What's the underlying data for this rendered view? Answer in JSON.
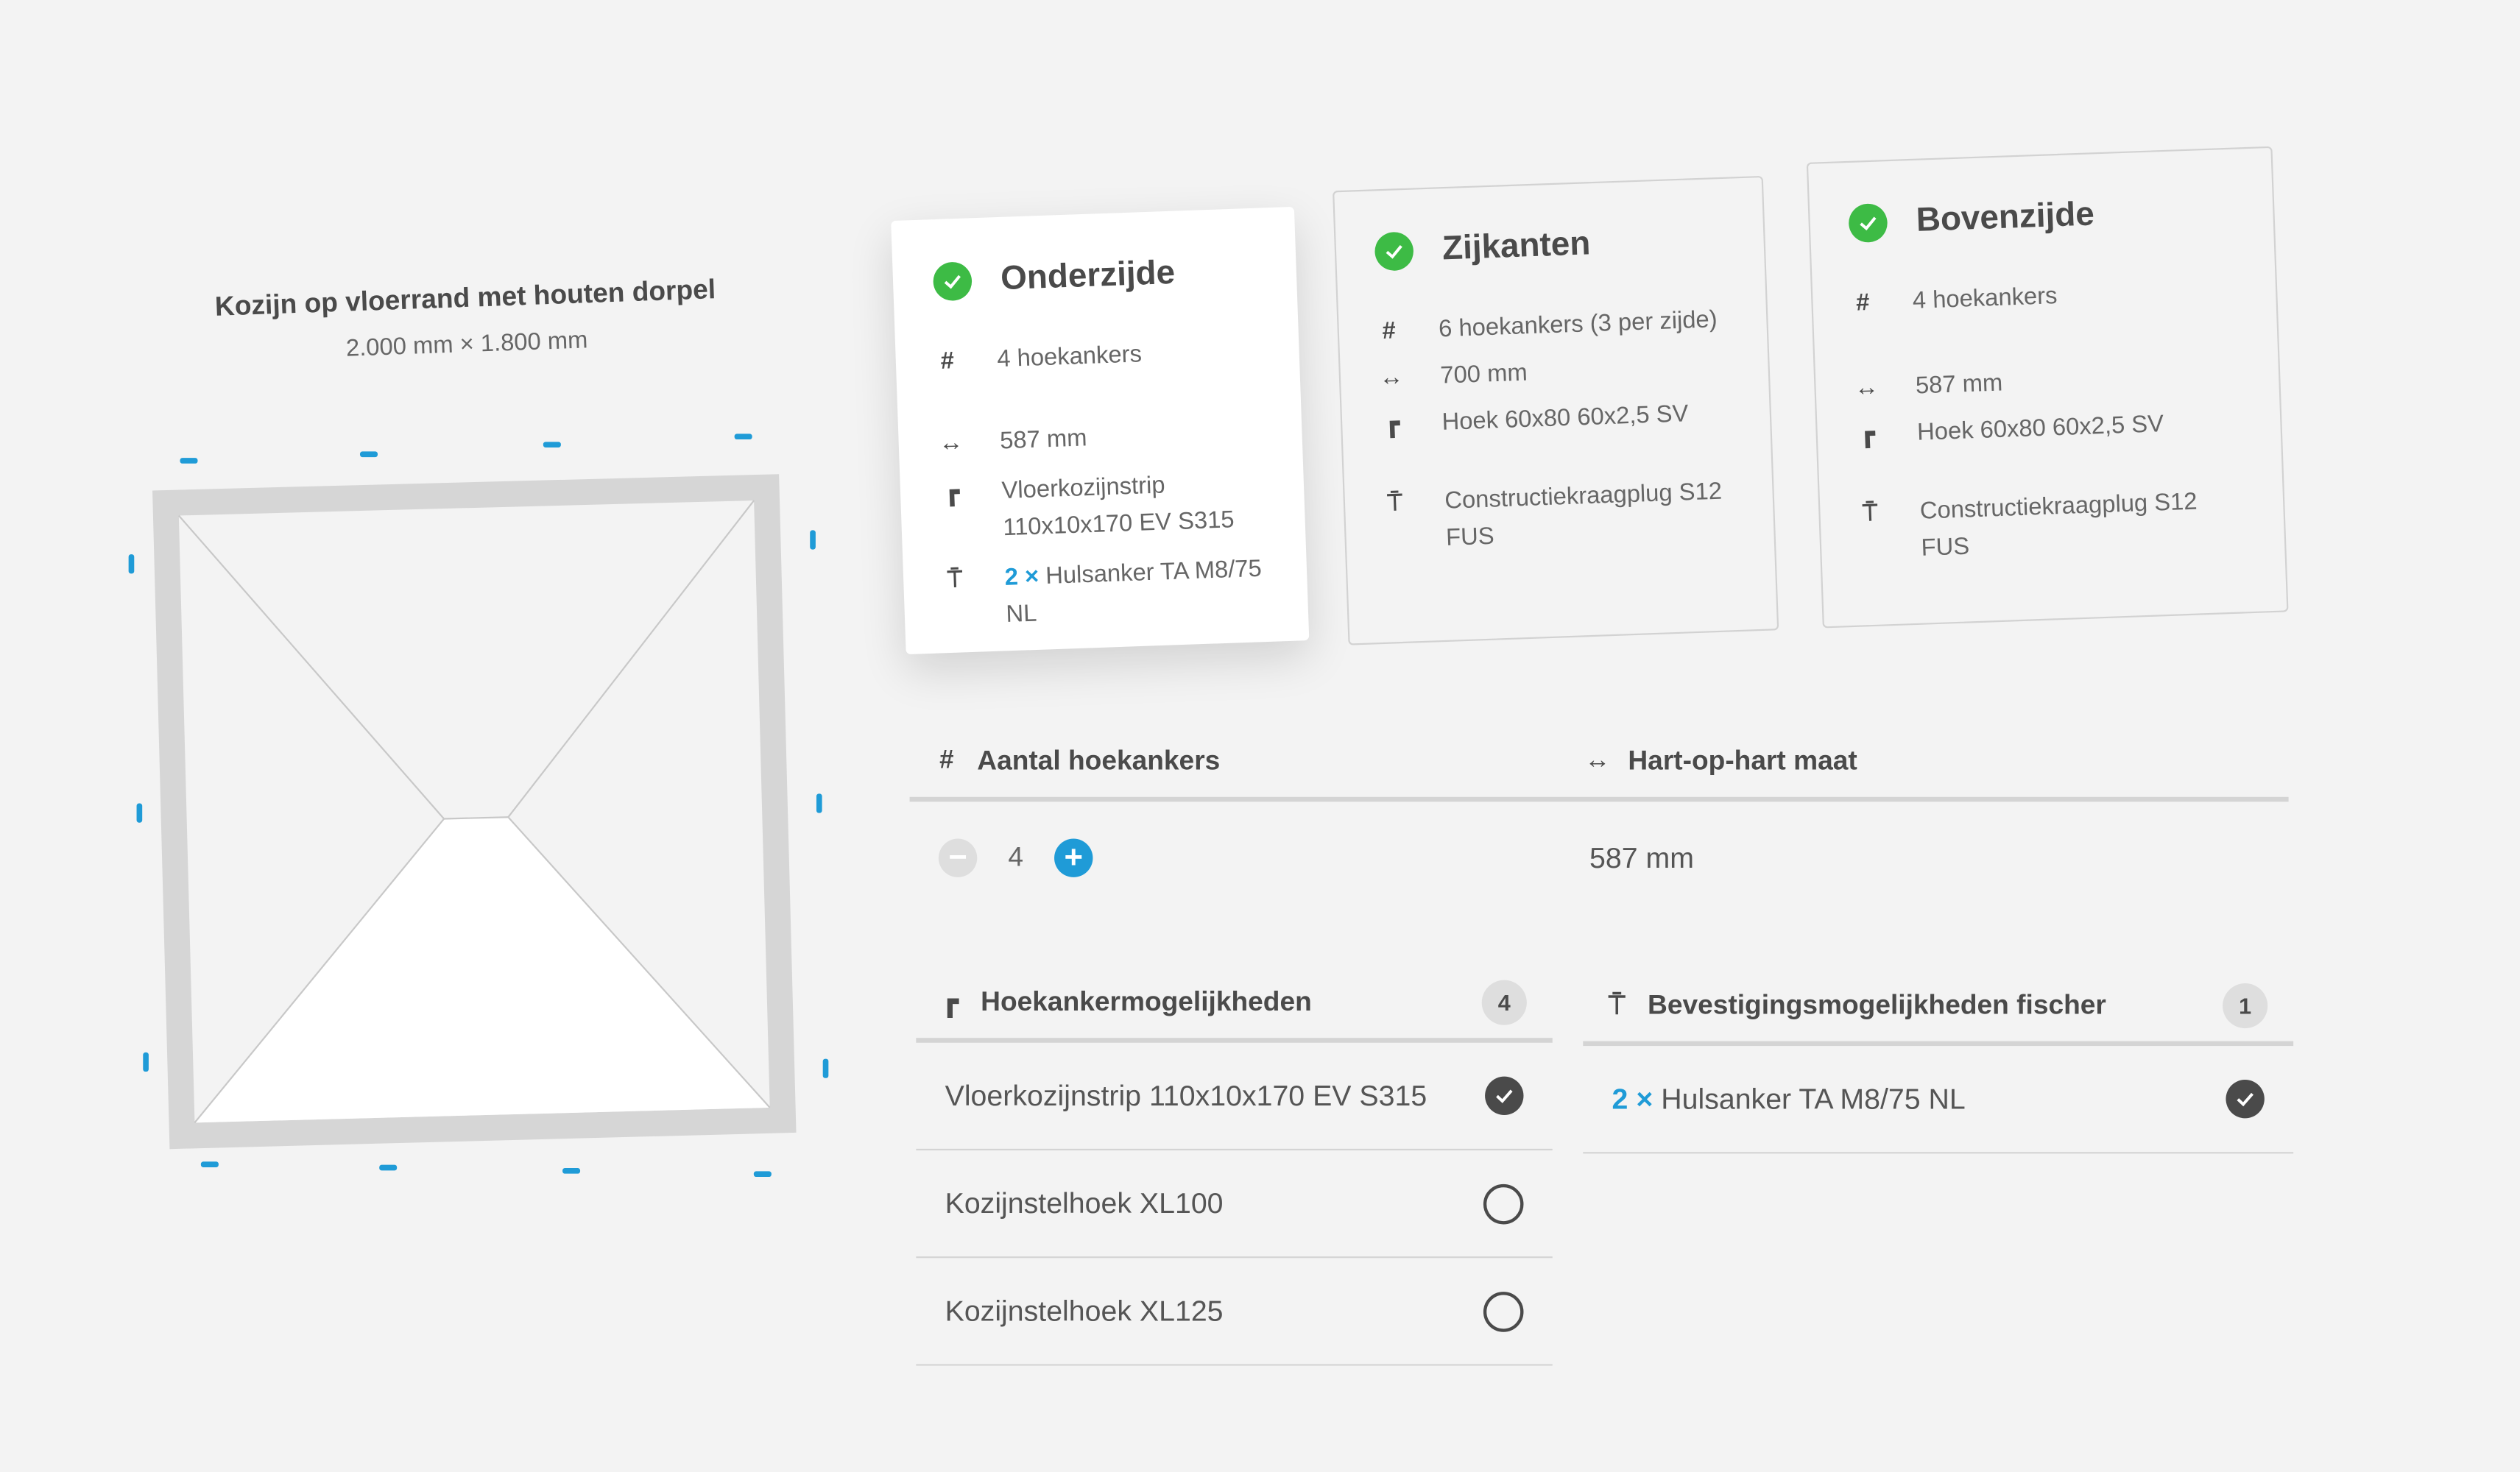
{
  "frame": {
    "title": "Kozijn op vloerrand met houten dorpel",
    "dimensions": "2.000 mm × 1.800 mm"
  },
  "cards": [
    {
      "title": "Onderzijde",
      "active": true,
      "anchors": "4 hoekankers",
      "distance": "587 mm",
      "product": "Vloerkozijnstrip 110x10x170 EV S315",
      "fastener_qty": "2 ×",
      "fastener": "Hulsanker TA M8/75 NL"
    },
    {
      "title": "Zijkanten",
      "active": false,
      "anchors": "6 hoekankers (3 per zijde)",
      "distance": "700 mm",
      "product": "Hoek 60x80 60x2,5 SV",
      "fastener": "Constructiekraagplug S12 FUS"
    },
    {
      "title": "Bovenzijde",
      "active": false,
      "anchors": "4 hoekankers",
      "distance": "587 mm",
      "product": "Hoek 60x80 60x2,5 SV",
      "fastener": "Constructiekraagplug S12 FUS"
    }
  ],
  "settings": {
    "count_label": "Aantal hoekankers",
    "count_value": "4",
    "minus": "−",
    "plus": "+",
    "spacing_label": "Hart-op-hart maat",
    "spacing_value": "587 mm"
  },
  "anchor_options": {
    "title": "Hoekankermogelijkheden",
    "count": "4",
    "items": [
      {
        "label": "Vloerkozijnstrip 110x10x170 EV S315",
        "selected": true
      },
      {
        "label": "Kozijnstelhoek XL100",
        "selected": false
      },
      {
        "label": "Kozijnstelhoek XL125",
        "selected": false
      }
    ]
  },
  "fixing_options": {
    "title": "Bevestigingsmogelijkheden fischer",
    "count": "1",
    "items": [
      {
        "qty": "2 ×",
        "label": "Hulsanker TA M8/75 NL",
        "selected": true
      }
    ]
  },
  "icons": {
    "count": "hash-icon",
    "distance": "double-arrow-icon",
    "product": "angle-bracket-icon",
    "fastener": "screw-icon",
    "check": "check-icon"
  },
  "colors": {
    "accent": "#1f9bd7",
    "success": "#3dbb45",
    "text": "#4a4a4a"
  }
}
